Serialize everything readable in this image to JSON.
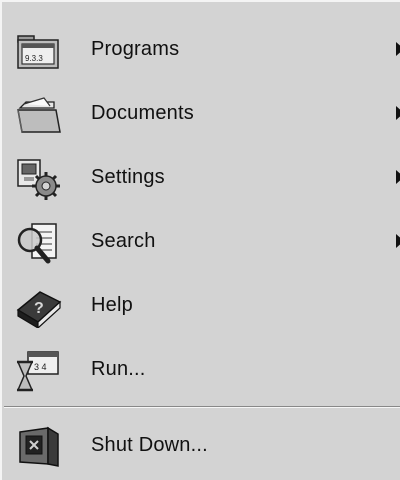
{
  "menu": {
    "items": [
      {
        "label": "Programs",
        "icon": "programs-folder-icon",
        "submenu": true
      },
      {
        "label": "Documents",
        "icon": "documents-folder-icon",
        "submenu": true
      },
      {
        "label": "Settings",
        "icon": "settings-gear-icon",
        "submenu": true
      },
      {
        "label": "Search",
        "icon": "search-magnifier-icon",
        "submenu": true
      },
      {
        "label": "Help",
        "icon": "help-book-icon",
        "submenu": false
      },
      {
        "label": "Run...",
        "icon": "run-hourglass-icon",
        "submenu": false
      }
    ],
    "shutdown": {
      "label": "Shut Down...",
      "icon": "shutdown-computer-icon"
    }
  }
}
